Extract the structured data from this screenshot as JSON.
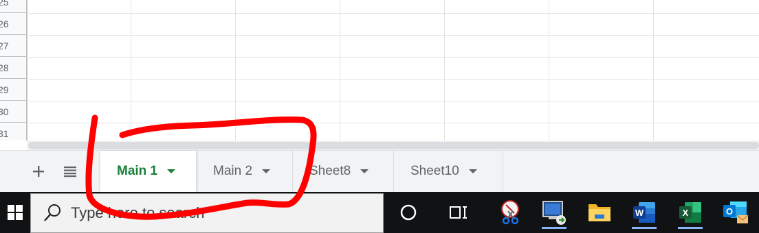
{
  "grid": {
    "row_numbers": [
      "25",
      "26",
      "27",
      "28",
      "29",
      "30",
      "31"
    ]
  },
  "sheet_tabs": {
    "add_icon": "plus-icon",
    "all_sheets_icon": "list-icon",
    "tabs": [
      {
        "label": "Main 1",
        "active": true
      },
      {
        "label": "Main 2",
        "active": false
      },
      {
        "label": "Sheet8",
        "active": false
      },
      {
        "label": "Sheet10",
        "active": false
      }
    ],
    "active_color": "#188038"
  },
  "taskbar": {
    "search_placeholder": "Type here to search",
    "apps": [
      "cortana-icon",
      "task-view-icon",
      "snipping-tool-icon",
      "remote-desktop-icon",
      "file-explorer-icon",
      "word-icon",
      "excel-icon",
      "outlook-icon"
    ]
  },
  "annotation": {
    "color": "#ff0000",
    "description_shape": "red freehand circle around sheet tabs"
  }
}
